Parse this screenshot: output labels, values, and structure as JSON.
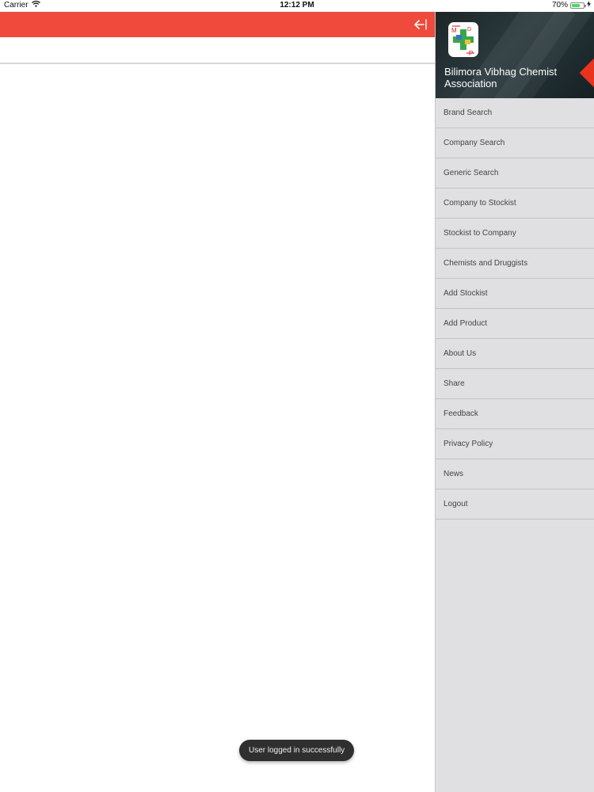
{
  "status_bar": {
    "carrier": "Carrier",
    "time": "12:12 PM",
    "battery_percent": "70%",
    "battery_level": 0.7
  },
  "app_bar": {
    "color": "#ef4a3b",
    "toggle_icon": "drawer-close-arrow-icon"
  },
  "drawer": {
    "title": "Bilimora Vibhag Chemist Association",
    "logo_letters": [
      "M",
      "D",
      "P"
    ],
    "items": [
      {
        "label": "Brand Search"
      },
      {
        "label": "Company Search"
      },
      {
        "label": "Generic Search"
      },
      {
        "label": "Company to Stockist"
      },
      {
        "label": "Stockist to Company"
      },
      {
        "label": "Chemists and Druggists"
      },
      {
        "label": "Add Stockist"
      },
      {
        "label": "Add Product"
      },
      {
        "label": "About Us"
      },
      {
        "label": "Share"
      },
      {
        "label": "Feedback"
      },
      {
        "label": "Privacy Policy"
      },
      {
        "label": "News"
      },
      {
        "label": "Logout"
      }
    ]
  },
  "toast": {
    "message": "User logged in successfully"
  }
}
